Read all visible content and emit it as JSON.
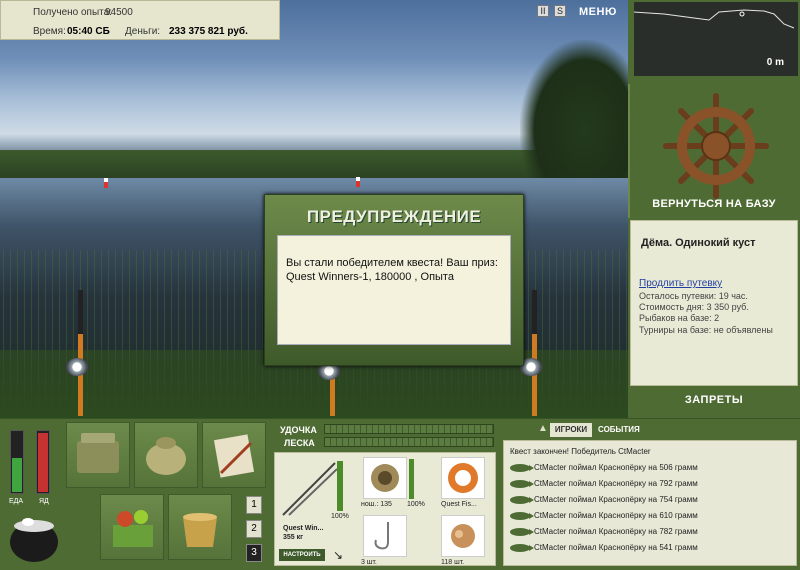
{
  "info": {
    "exp_label": "Получено опыта:",
    "exp_value": "94500",
    "time_label": "Время:",
    "time_value": "05:40 СБ",
    "money_label": "Деньги:",
    "money_value": "233 375 821 руб."
  },
  "top_buttons": {
    "pause": "II",
    "sound": "S",
    "menu": "МЕНЮ"
  },
  "depth": {
    "value": "0 m"
  },
  "right_panel": {
    "back_to_base": "ВЕРНУТЬСЯ НА БАЗУ",
    "base_name": "Дёма. Одинокий куст",
    "extend_link": "Продлить путевку",
    "remaining": "Осталось путевки: 19 час.",
    "day_cost": "Стоимость дня: 3 350 руб.",
    "fishers": "Рыбаков на базе: 2",
    "tournaments": "Турниры на базе: не объявлены",
    "bans": "ЗАПРЕТЫ"
  },
  "dialog": {
    "title": "ПРЕДУПРЕЖДЕНИЕ",
    "text": "Вы стали победителем квеста! Ваш приз: Quest Winners-1, 180000 , Опыта"
  },
  "meters": {
    "food_label": "ЕДА",
    "poison_label": "ЯД",
    "food_level": 0.55,
    "poison_level": 0.95
  },
  "pages": [
    "1",
    "2",
    "3"
  ],
  "rod_line": {
    "rod_label": "УДОЧКА",
    "line_label": "ЛЕСКА"
  },
  "tackle": {
    "rod_name": "Quest Win...",
    "rod_weight": "355 кг",
    "rod_percent": "100%",
    "setup_button": "НАСТРОИТЬ",
    "reel_caption": "нош.: 135",
    "reel_percent": "100%",
    "line_caption": "Quest Fis...",
    "hook_caption": "3 шт.",
    "bait_caption": "118 шт."
  },
  "events": {
    "tab_players": "ИГРОКИ",
    "tab_events": "СОБЫТИЯ",
    "header": "Квест закончен! Победитель CtMacter",
    "rows": [
      "CtMacter поймал Краснопёрку на 506 грамм",
      "CtMacter поймал Краснопёрку на 792 грамм",
      "CtMacter поймал Краснопёрку на 754 грамм",
      "CtMacter поймал Краснопёрку на 610 грамм",
      "CtMacter поймал Краснопёрку на 782 грамм",
      "CtMacter поймал Краснопёрку на 541 грамм"
    ]
  }
}
